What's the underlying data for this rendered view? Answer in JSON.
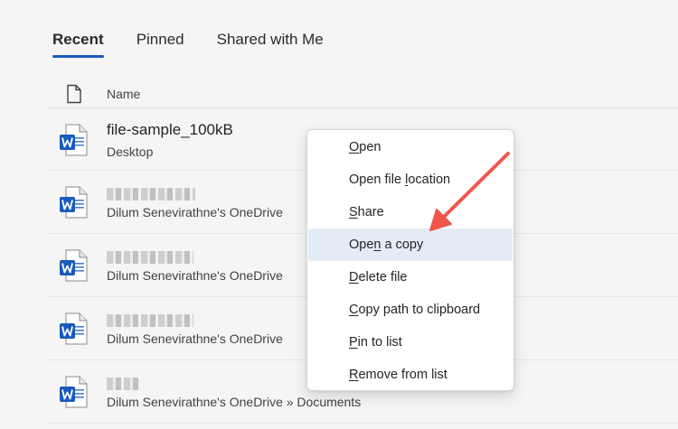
{
  "tabs": [
    {
      "label": "Recent",
      "active": true
    },
    {
      "label": "Pinned",
      "active": false
    },
    {
      "label": "Shared with Me",
      "active": false
    }
  ],
  "header": {
    "name_label": "Name",
    "icon": "document-outline-icon"
  },
  "files": [
    {
      "name": "file-sample_100kB",
      "location": "Desktop",
      "name_blurred": false,
      "icon": "word-doc-icon"
    },
    {
      "name": "",
      "location": "Dilum Senevirathne's OneDrive",
      "name_blurred": true,
      "icon": "word-doc-icon"
    },
    {
      "name": "",
      "location": "Dilum Senevirathne's OneDrive",
      "name_blurred": true,
      "icon": "word-doc-icon"
    },
    {
      "name": "",
      "location": "Dilum Senevirathne's OneDrive",
      "name_blurred": true,
      "icon": "word-doc-icon"
    },
    {
      "name": "",
      "location": "Dilum Senevirathne's OneDrive » Documents",
      "name_blurred": true,
      "icon": "word-doc-icon"
    }
  ],
  "context_menu": {
    "items": [
      {
        "pre": "",
        "key": "O",
        "post": "pen"
      },
      {
        "pre": "Open file ",
        "key": "l",
        "post": "ocation"
      },
      {
        "pre": "",
        "key": "S",
        "post": "hare"
      },
      {
        "pre": "Ope",
        "key": "n",
        "post": " a copy"
      },
      {
        "pre": "",
        "key": "D",
        "post": "elete file"
      },
      {
        "pre": "",
        "key": "C",
        "post": "opy path to clipboard"
      },
      {
        "pre": "",
        "key": "P",
        "post": "in to list"
      },
      {
        "pre": "",
        "key": "R",
        "post": "emove from list"
      }
    ],
    "highlighted_index": 3
  },
  "colors": {
    "accent": "#185abd",
    "word_blue": "#185abd",
    "arrow": "#f0564a",
    "highlight": "#e3ebf7"
  }
}
